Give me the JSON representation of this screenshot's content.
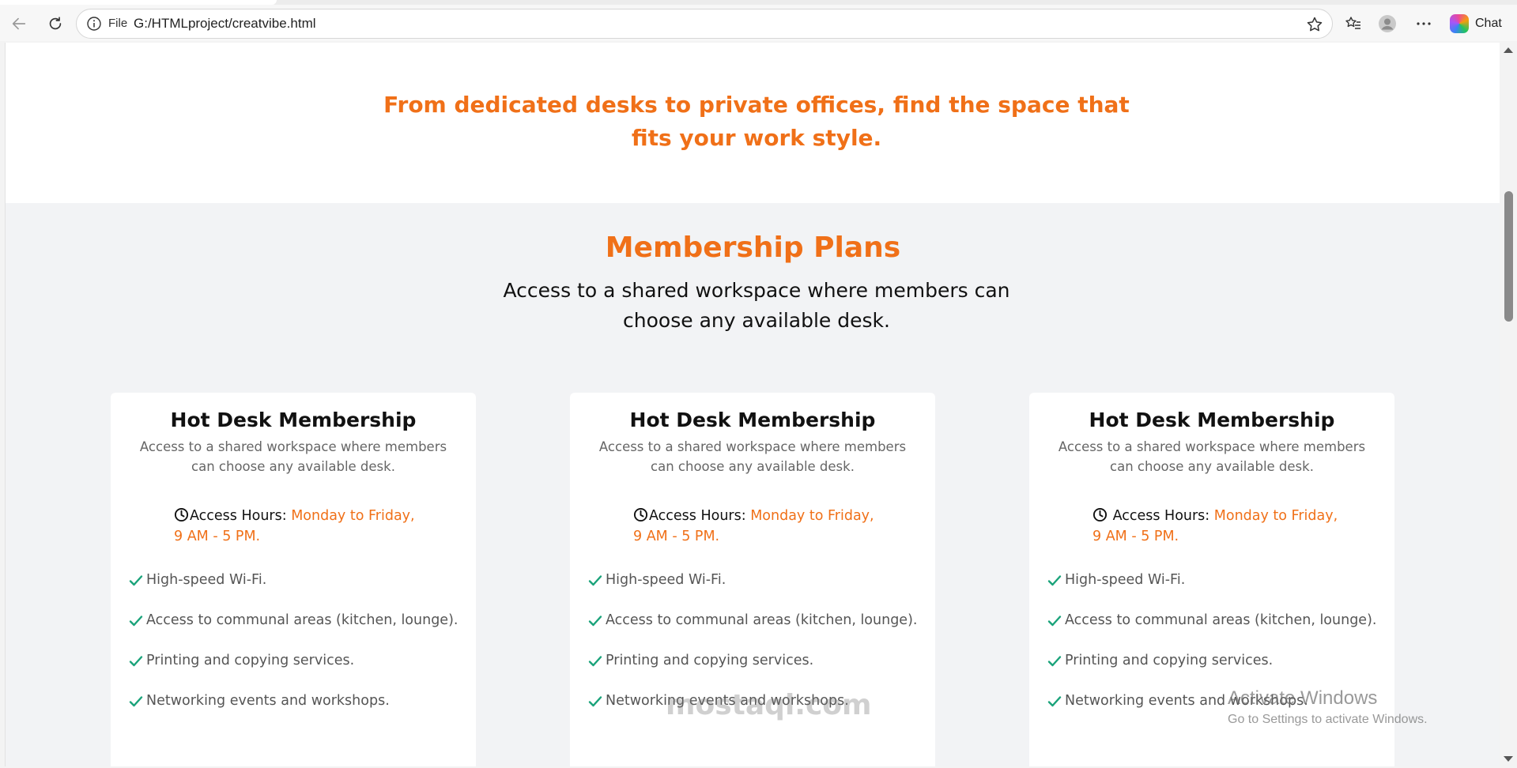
{
  "browser": {
    "scheme_label": "File",
    "url": "G:/HTMLproject/creatvibe.html",
    "chat_label": "Chat",
    "icons": [
      "back-icon",
      "refresh-icon",
      "info-icon",
      "star-icon",
      "favorites-icon",
      "profile-icon",
      "more-icon",
      "copilot-icon"
    ]
  },
  "hero": {
    "tagline": "From dedicated desks to private offices, find the space that fits your work style."
  },
  "plans": {
    "title": "Membership Plans",
    "subtitle": "Access to a shared workspace where members can choose any available desk.",
    "cards": [
      {
        "title": "Hot Desk Membership",
        "description": "Access to a shared workspace where members can choose any available desk.",
        "hours_label": "Access Hours: ",
        "hours_value_1": "Monday to Friday,",
        "hours_value_2": "9 AM - 5 PM.",
        "features": [
          "High-speed Wi-Fi.",
          "Access to communal areas (kitchen, lounge).",
          "Printing and copying services.",
          "Networking events and workshops."
        ]
      },
      {
        "title": "Hot Desk Membership",
        "description": "Access to a shared workspace where members can choose any available desk.",
        "hours_label": "Access Hours: ",
        "hours_value_1": "Monday to Friday,",
        "hours_value_2": "9 AM - 5 PM.",
        "features": [
          "High-speed Wi-Fi.",
          "Access to communal areas (kitchen, lounge).",
          "Printing and copying services.",
          "Networking events and workshops."
        ]
      },
      {
        "title": "Hot Desk Membership",
        "description": "Access to a shared workspace where members can choose any available desk.",
        "hours_label": " Access Hours: ",
        "hours_value_1": "Monday to Friday,",
        "hours_value_2": "9 AM - 5 PM.",
        "features": [
          "High-speed Wi-Fi.",
          "Access to communal areas (kitchen, lounge).",
          "Printing and copying services.",
          "Networking events and workshops."
        ]
      }
    ]
  },
  "overlays": {
    "watermark": "mostaql.com",
    "activate_title": "Activate Windows",
    "activate_sub": "Go to Settings to activate Windows."
  },
  "colors": {
    "accent": "#f07018",
    "check": "#1aa37a",
    "section_bg": "#f2f3f5"
  }
}
